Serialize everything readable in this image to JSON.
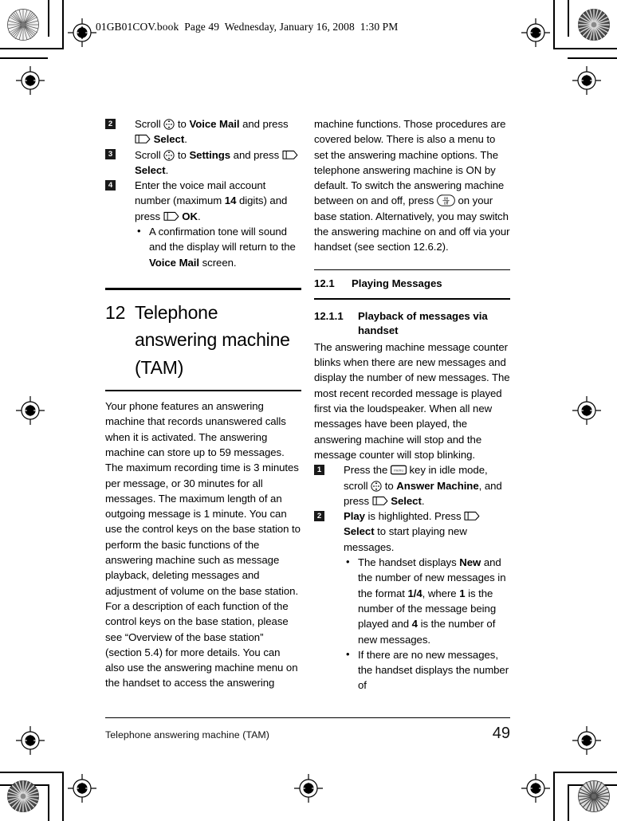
{
  "page_header": "01GB01COV.book  Page 49  Wednesday, January 16, 2008  1:30 PM",
  "icons": {
    "scroll_key": "scroll-key-icon",
    "soft_key": "soft-key-icon",
    "onoff_key": "on-off-key-icon",
    "menu_key": "menu-key-icon",
    "onoff_label_top": "on",
    "onoff_label_bottom": "off",
    "menu_label": "menu"
  },
  "left_column": {
    "steps": [
      {
        "num": "2",
        "parts": [
          {
            "t": "Scroll "
          },
          {
            "icon": "scroll"
          },
          {
            "t": " to "
          },
          {
            "t": "Voice Mail",
            "b": true
          },
          {
            "t": " and press "
          },
          {
            "icon": "soft"
          },
          {
            "t": " "
          },
          {
            "t": "Select",
            "b": true
          },
          {
            "t": "."
          }
        ]
      },
      {
        "num": "3",
        "parts": [
          {
            "t": "Scroll "
          },
          {
            "icon": "scroll"
          },
          {
            "t": " to "
          },
          {
            "t": "Settings",
            "b": true
          },
          {
            "t": " and press "
          },
          {
            "icon": "soft"
          },
          {
            "t": " "
          },
          {
            "t": "Select",
            "b": true
          },
          {
            "t": "."
          }
        ]
      },
      {
        "num": "4",
        "parts": [
          {
            "t": "Enter the voice mail account number (maximum "
          },
          {
            "t": "14",
            "b": true
          },
          {
            "t": " digits) and press "
          },
          {
            "icon": "soft"
          },
          {
            "t": " "
          },
          {
            "t": "OK",
            "b": true
          },
          {
            "t": "."
          }
        ],
        "substeps": [
          [
            {
              "t": "A confirmation tone will sound and the display will return to the "
            },
            {
              "t": "Voice Mail",
              "b": true
            },
            {
              "t": " screen."
            }
          ]
        ]
      }
    ],
    "chapter": {
      "number": "12",
      "title": "Telephone answering machine (TAM)"
    },
    "intro": "Your phone features an answering machine that records unanswered calls when it is activated. The answering machine can store up to 59 messages. The maximum recording time is 3 minutes per message, or 30 minutes for all messages. The maximum length of an outgoing message is 1 minute. You can use the control keys on the base station to perform the basic functions of the answering machine such as message playback, deleting messages and adjustment of volume on the base station. For a description of each function of the control keys on the base station, please see “Overview of the base station” (section 5.4) for more details. You can also use the answering machine menu on the handset to access the answering"
  },
  "right_column": {
    "continuation_parts": [
      {
        "t": "machine functions. Those procedures are covered below. There is also a menu to set the answering machine options. The telephone answering machine is ON by default. To switch the answering machine between on and off, press "
      },
      {
        "icon": "onoff"
      },
      {
        "t": " on your base station. Alternatively, you may switch the answering machine on and off via your handset (see section 12.6.2)."
      }
    ],
    "section": {
      "number": "12.1",
      "title": "Playing Messages"
    },
    "subsection": {
      "number": "12.1.1",
      "title": "Playback of messages via handset"
    },
    "intro": "The answering machine message counter blinks when there are new messages and display the number of new messages. The most recent recorded message is played first via the loudspeaker. When all new messages have been played, the answering machine will stop and the message counter will stop blinking.",
    "steps": [
      {
        "num": "1",
        "parts": [
          {
            "t": "Press the "
          },
          {
            "icon": "menu"
          },
          {
            "t": " key in idle mode, scroll "
          },
          {
            "icon": "scroll"
          },
          {
            "t": " to "
          },
          {
            "t": "Answer Machine",
            "b": true
          },
          {
            "t": ", and press "
          },
          {
            "icon": "soft"
          },
          {
            "t": " "
          },
          {
            "t": "Select",
            "b": true
          },
          {
            "t": "."
          }
        ]
      },
      {
        "num": "2",
        "parts": [
          {
            "t": "Play",
            "b": true
          },
          {
            "t": " is highlighted. Press "
          },
          {
            "icon": "soft"
          },
          {
            "t": " "
          },
          {
            "t": "Select",
            "b": true
          },
          {
            "t": " to start playing new messages."
          }
        ],
        "substeps": [
          [
            {
              "t": "The handset displays "
            },
            {
              "t": "New",
              "b": true
            },
            {
              "t": " and the number of new messages in the format "
            },
            {
              "t": "1/4",
              "b": true
            },
            {
              "t": ", where "
            },
            {
              "t": "1",
              "b": true
            },
            {
              "t": " is the number of the message being played and "
            },
            {
              "t": "4",
              "b": true
            },
            {
              "t": " is the number of new messages."
            }
          ],
          [
            {
              "t": "If there are no new messages, the handset displays the number of"
            }
          ]
        ]
      }
    ]
  },
  "footer": {
    "text": "Telephone answering machine (TAM)",
    "page_number": "49"
  }
}
